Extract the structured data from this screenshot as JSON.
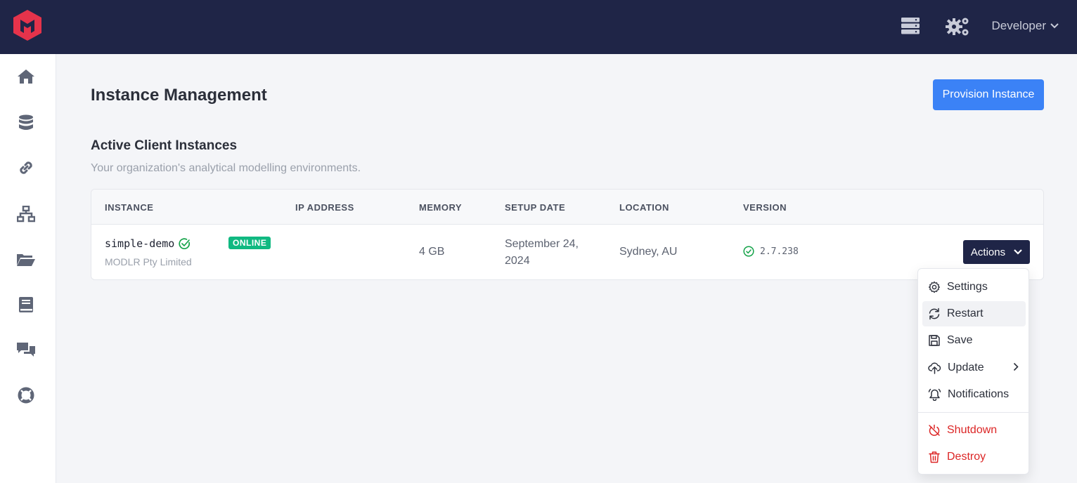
{
  "topbar": {
    "logo_icon": "modlr-logo-icon",
    "server_icon": "server-stack-icon",
    "settings_icon": "gears-icon",
    "user_label": "Developer"
  },
  "sidebar": {
    "items": [
      {
        "icon": "home-icon"
      },
      {
        "icon": "database-icon"
      },
      {
        "icon": "link-icon"
      },
      {
        "icon": "network-icon"
      },
      {
        "icon": "folder-icon"
      },
      {
        "icon": "book-icon"
      },
      {
        "icon": "chat-icon"
      },
      {
        "icon": "lifebuoy-icon"
      }
    ]
  },
  "main": {
    "title": "Instance Management",
    "provision_button": "Provision Instance",
    "section_title": "Active Client Instances",
    "section_subtitle": "Your organization's analytical modelling environments."
  },
  "table": {
    "columns": [
      "INSTANCE",
      "IP ADDRESS",
      "MEMORY",
      "SETUP DATE",
      "LOCATION",
      "VERSION"
    ],
    "rows": [
      {
        "name": "simple-demo",
        "org": "MODLR Pty Limited",
        "status": "ONLINE",
        "ip": "",
        "memory": "4 GB",
        "setup_date_line1": "September 24,",
        "setup_date_line2": "2024",
        "location": "Sydney, AU",
        "version": "2.7.238",
        "actions_label": "Actions"
      }
    ]
  },
  "actions_menu": {
    "items": [
      {
        "label": "Settings",
        "icon": "gear-icon"
      },
      {
        "label": "Restart",
        "icon": "refresh-icon"
      },
      {
        "label": "Save",
        "icon": "floppy-disk-icon"
      },
      {
        "label": "Update",
        "icon": "cloud-upload-icon"
      },
      {
        "label": "Notifications",
        "icon": "bell-icon"
      },
      {
        "label": "Shutdown",
        "icon": "power-off-icon"
      },
      {
        "label": "Destroy",
        "icon": "trash-icon"
      }
    ]
  },
  "colors": {
    "topbar": "#1f2547",
    "brand_red": "#e5334b",
    "primary_button": "#3b82f6",
    "online_badge": "#10b981",
    "danger": "#dc2626"
  }
}
